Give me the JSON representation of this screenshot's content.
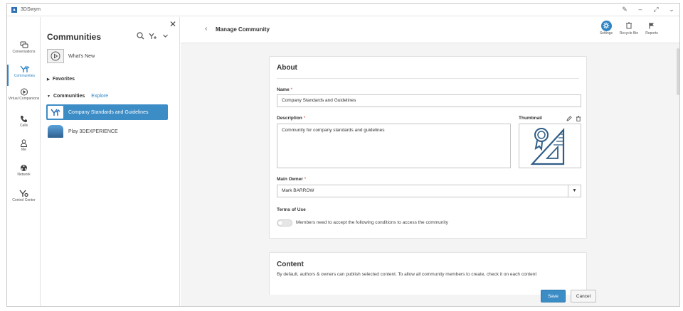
{
  "app": {
    "name": "3DSwym",
    "logo_icon": "3ds-logo-icon",
    "accent": "#2d83c4"
  },
  "window_controls": [
    "pencil-icon",
    "minimize-icon",
    "expand-icon",
    "chevron-down-icon"
  ],
  "nav": {
    "items": [
      {
        "label": "Conversations",
        "icon": "conversations-icon",
        "active": false
      },
      {
        "label": "Communities",
        "icon": "communities-icon",
        "active": true
      },
      {
        "label": "Virtual Companions",
        "icon": "virtual-companions-icon",
        "active": false
      },
      {
        "label": "Calls",
        "icon": "phone-icon",
        "active": false
      },
      {
        "label": "Me",
        "icon": "user-icon",
        "active": false
      },
      {
        "label": "Network",
        "icon": "network-icon",
        "active": false
      },
      {
        "label": "Control Center",
        "icon": "control-center-icon",
        "active": false
      }
    ]
  },
  "panel": {
    "title": "Communities",
    "whats_new": "What's New",
    "favorites": "Favorites",
    "communities": "Communities",
    "explore": "Explore",
    "items": [
      {
        "label": "Company Standards and Guidelines",
        "selected": true
      },
      {
        "label": "Play 3DEXPERIENCE",
        "selected": false
      }
    ]
  },
  "main": {
    "title": "Manage Community",
    "actions": [
      {
        "label": "Settings",
        "icon": "gear-icon"
      },
      {
        "label": "Recycle Bin",
        "icon": "recycle-bin-icon"
      },
      {
        "label": "Reports",
        "icon": "flag-icon"
      }
    ]
  },
  "about": {
    "title": "About",
    "name_label": "Name",
    "name_value": "Company Standards and Guidelines",
    "description_label": "Description",
    "description_value": "Community for company standards and guidelines",
    "thumbnail_label": "Thumbnail",
    "main_owner_label": "Main Owner",
    "main_owner_value": "Mark BARROW",
    "terms_label": "Terms of Use",
    "terms_text": "Members need to accept the following conditions to access the community",
    "required_mark": "*"
  },
  "content": {
    "title": "Content",
    "description": "By default, authors & owners can publish selected content. To allow all community members to create, check it on each content"
  },
  "footer": {
    "save": "Save",
    "cancel": "Cancel"
  }
}
